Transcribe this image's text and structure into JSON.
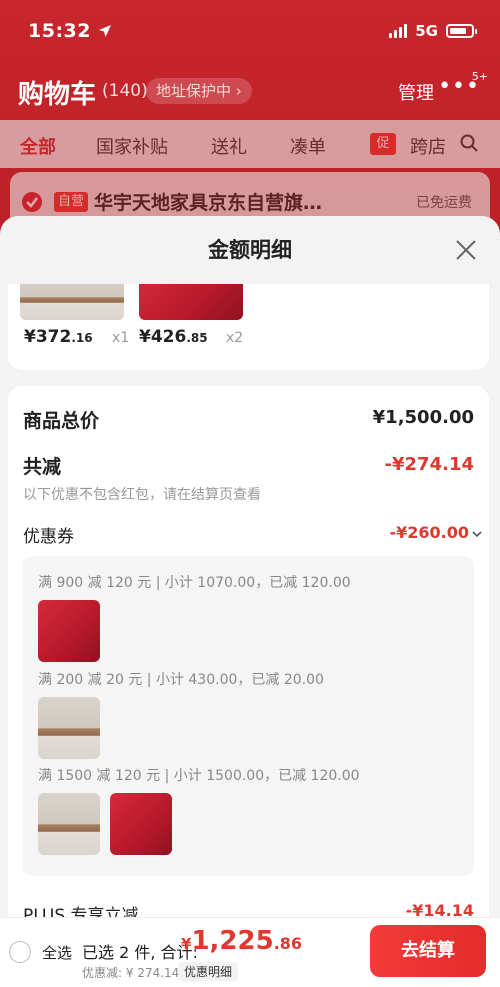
{
  "status_bar": {
    "time": "15:32",
    "network": "5G"
  },
  "cart_header": {
    "title": "购物车",
    "count": "(140)",
    "address_pill": "地址保护中 ›",
    "manage": "管理",
    "more": "•••",
    "more_badge": "5+"
  },
  "tabs": [
    {
      "label": "全部"
    },
    {
      "label": "国家补贴"
    },
    {
      "label": "送礼"
    },
    {
      "label": "凑单"
    },
    {
      "label": "跨店"
    }
  ],
  "promo_tag": "促",
  "store": {
    "tag": "自营",
    "name": "华宇天地家具京东自营旗…",
    "shipping": "已免运费"
  },
  "sheet": {
    "title": "金额明细",
    "products": [
      {
        "price_int": "¥372",
        "price_dec": ".16",
        "qty": "x1"
      },
      {
        "price_int": "¥426",
        "price_dec": ".85",
        "qty": "x2"
      }
    ],
    "rows": {
      "total_label": "商品总价",
      "total_value": "¥1,500.00",
      "reduce_label": "共减",
      "reduce_value": "-¥274.14",
      "reduce_note": "以下优惠不包含红包，请在结算页查看",
      "coupon_label": "优惠券",
      "coupon_value": "-¥260.00"
    },
    "coupons": [
      {
        "text": "满 900 减 120 元 | 小计 1070.00，已减 120.00"
      },
      {
        "text": "满 200 减 20 元 | 小计 430.00，已减 20.00"
      },
      {
        "text": "满 1500 减 120 元 | 小计 1500.00，已减 120.00"
      }
    ],
    "plus": {
      "label": "PLUS 专享立减",
      "value": "-¥14.14"
    }
  },
  "bottom_bar": {
    "select_all": "全选",
    "selected": "已选 2 件, 合计:",
    "total_yen": "¥",
    "total_int": "1,225",
    "total_dec": ".86",
    "discount": "优惠减: ¥ 274.14",
    "detail": "优惠明细",
    "checkout": "去结算"
  },
  "colors": {
    "accent": "#e0372f",
    "brand": "#c9282e"
  }
}
